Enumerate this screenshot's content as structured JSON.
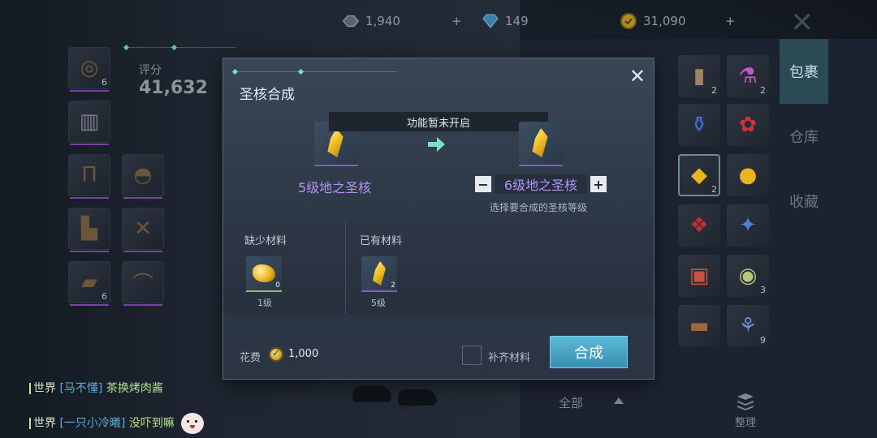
{
  "resources": [
    {
      "name": "bound-gem",
      "value": "1,940",
      "icon": "bound-gem-icon"
    },
    {
      "name": "diamond",
      "value": "149",
      "icon": "diamond-icon"
    },
    {
      "name": "gold",
      "value": "31,090",
      "icon": "gold-coin-icon"
    }
  ],
  "character": {
    "score_label": "评分",
    "score_value": "41,632"
  },
  "bag": {
    "tabs": [
      "包裹",
      "仓库",
      "收藏"
    ],
    "active_tab": "包裹",
    "counts": {
      "r0c0": "",
      "r0c1": "2",
      "r0c2": "2",
      "r2c1": "2",
      "r5c3": "3",
      "r6c3": "9"
    },
    "filter_label": "全部",
    "sort_label": "整理"
  },
  "chat": [
    {
      "channel": "世界",
      "name": "[马不懂]",
      "message": "茶换烤肉酱"
    },
    {
      "channel": "世界",
      "name": "[一只小冷曦]",
      "message": "没吓到嘛"
    }
  ],
  "modal": {
    "title": "圣核合成",
    "banner": "功能暂未开启",
    "source_label": "5级地之圣核",
    "target_label": "6级地之圣核",
    "minus": "−",
    "plus": "+",
    "hint": "选择要合成的圣核等级",
    "missing_label": "缺少材料",
    "owned_label": "已有材料",
    "missing_item": {
      "count": "0",
      "level": "1级"
    },
    "owned_item": {
      "count": "2",
      "level": "5级"
    },
    "cost_label": "花费",
    "cost_value": "1,000",
    "autofill_label": "补齐材料",
    "confirm_label": "合成",
    "close": "✕"
  },
  "colors": {
    "accent": "#4aa6c8",
    "purple_text": "#b494f0",
    "chat_green": "#b5e18d",
    "chat_blue": "#5ab0de"
  }
}
